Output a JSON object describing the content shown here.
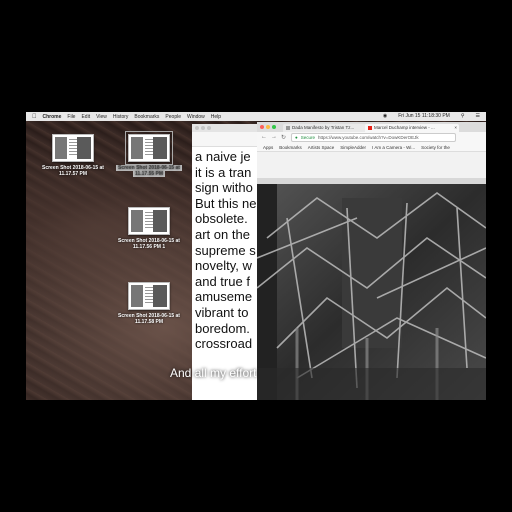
{
  "menubar": {
    "app_name": "Chrome",
    "items": [
      "File",
      "Edit",
      "View",
      "History",
      "Bookmarks",
      "People",
      "Window",
      "Help"
    ],
    "clock": "Fri Jun 15  11:18:30 PM"
  },
  "desktop": {
    "icons": [
      {
        "label_line1": "Screen Shot 2018-06-15 at",
        "label_line2": "11.17.57 PM"
      },
      {
        "label_line1": "Screen Shot 2018-06-15 at",
        "label_line2": "11.17.55 PM"
      },
      {
        "label_line1": "Screen Shot 2018-06-15 at",
        "label_line2": "11.17.56 PM 1"
      },
      {
        "label_line1": "Screen Shot 2018-06-15 at",
        "label_line2": "11.17.58 PM"
      }
    ]
  },
  "document": {
    "lines": [
      "a naive je",
      "it is a tran",
      "sign witho",
      "But this ne",
      "obsolete.",
      "art on the",
      "supreme s",
      "novelty, w",
      "and true f",
      "amuseme",
      "vibrant to",
      "boredom.",
      "crossroad"
    ]
  },
  "browser": {
    "tabs": [
      {
        "label": "Dada Manifesto by Tristan Tz...",
        "active": false
      },
      {
        "label": "Marcel Duchamp interview - ...",
        "active": true
      }
    ],
    "secure_label": "Secure",
    "url": "https://www.youtube.com/watch?v=DowKDerOEJk",
    "bookmarks": [
      "Apps",
      "Bookmarks",
      "Artists Space",
      "SimpleAdder",
      "I Am a Camera - Wi...",
      "Society for the"
    ]
  },
  "subtitle": "And all my effort",
  "colors": {
    "screen_bg": "#2a1d1a",
    "menubar_bg": "#e8e8e8",
    "secure_green": "#1e8e3e",
    "youtube_red": "#e62117"
  }
}
